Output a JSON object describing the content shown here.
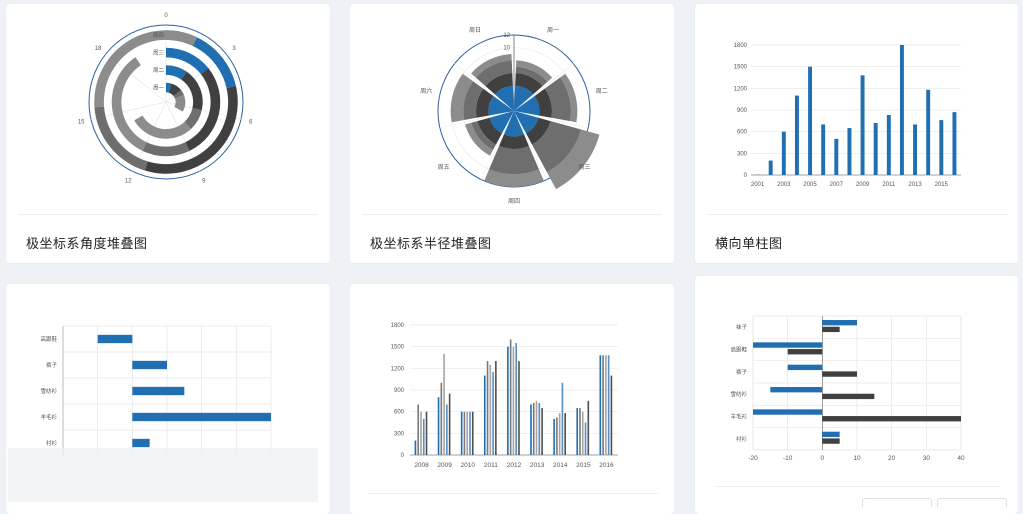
{
  "cards": [
    {
      "title": "极坐标系角度堆叠图"
    },
    {
      "title": "极坐标系半径堆叠图"
    },
    {
      "title": "横向单柱图"
    },
    {
      "title": ""
    },
    {
      "title": ""
    },
    {
      "title": ""
    }
  ],
  "colors": {
    "blue": "#1f6fb2",
    "dark": "#404040",
    "gray": "#6e6e6e",
    "light": "#8c8c8c"
  },
  "chart_data": [
    {
      "type": "bar",
      "subtype": "polar-angle-stacked",
      "angle_ticks": [
        "0",
        "3",
        "6",
        "9",
        "12",
        "15",
        "18"
      ],
      "angle_range": [
        0,
        21
      ],
      "categories": [
        "周一",
        "周二",
        "周三",
        "周四"
      ],
      "series": [
        {
          "values": [
            1,
            2,
            3,
            4.5
          ]
        },
        {
          "values": [
            2,
            4,
            6,
            7
          ]
        },
        {
          "values": [
            1,
            2,
            3,
            4
          ]
        },
        {
          "values": [
            3,
            6,
            7,
            7
          ]
        }
      ]
    },
    {
      "type": "bar",
      "subtype": "polar-radius-stacked",
      "categories": [
        "周一",
        "周二",
        "周三",
        "周四",
        "周五",
        "周六",
        "周日"
      ],
      "radial_ticks": [
        "4",
        "8",
        "10",
        "12"
      ],
      "series": [
        {
          "values": [
            4,
            4,
            4,
            4,
            4,
            4,
            4
          ]
        },
        {
          "values": [
            2,
            2,
            2,
            2,
            2,
            2,
            2
          ]
        },
        {
          "values": [
            1,
            3,
            5,
            4,
            1,
            2,
            2
          ]
        },
        {
          "values": [
            1,
            1,
            3,
            2,
            1,
            2,
            1
          ]
        }
      ]
    },
    {
      "type": "bar",
      "x": [
        2001,
        2002,
        2003,
        2004,
        2005,
        2006,
        2007,
        2008,
        2009,
        2010,
        2011,
        2012,
        2013,
        2014,
        2015,
        2016
      ],
      "x_tick_labels": [
        "2001",
        "2003",
        "2005",
        "2007",
        "2009",
        "2011",
        "2013",
        "2015"
      ],
      "values": [
        5,
        200,
        600,
        1100,
        1500,
        700,
        500,
        650,
        1380,
        720,
        830,
        1800,
        700,
        1180,
        760,
        870
      ],
      "y_ticks": [
        "0",
        "300",
        "600",
        "900",
        "1200",
        "1500",
        "1800"
      ],
      "ylim": [
        0,
        1800
      ]
    },
    {
      "type": "bar",
      "orientation": "horizontal",
      "categories": [
        "高跟鞋",
        "裤子",
        "雪纺衫",
        "羊毛衫",
        "衬衫"
      ],
      "values": [
        -10,
        10,
        15,
        40,
        5
      ],
      "xlim": [
        -20,
        40
      ]
    },
    {
      "type": "bar",
      "x": [
        2008,
        2009,
        2010,
        2011,
        2012,
        2013,
        2014,
        2015,
        2016
      ],
      "x_tick_labels": [
        "2008",
        "2009",
        "2010",
        "2011",
        "2012",
        "2013",
        "2014",
        "2015",
        "2016"
      ],
      "series": [
        {
          "values": [
            200,
            800,
            600,
            1100,
            1500,
            700,
            500,
            650,
            1380
          ]
        },
        {
          "values": [
            700,
            1000,
            600,
            1300,
            1600,
            720,
            520,
            650,
            1380
          ]
        },
        {
          "values": [
            600,
            1400,
            600,
            1250,
            1500,
            750,
            580,
            600,
            1380
          ]
        },
        {
          "values": [
            500,
            700,
            600,
            1150,
            1550,
            720,
            1000,
            450,
            1380
          ]
        },
        {
          "values": [
            600,
            850,
            600,
            1300,
            1300,
            650,
            580,
            750,
            1100
          ]
        }
      ],
      "y_ticks": [
        "0",
        "300",
        "600",
        "900",
        "1200",
        "1500",
        "1800"
      ],
      "ylim": [
        0,
        1800
      ]
    },
    {
      "type": "bar",
      "orientation": "horizontal",
      "categories": [
        "袜子",
        "高跟鞋",
        "裤子",
        "雪纺衫",
        "羊毛衫",
        "衬衫"
      ],
      "series": [
        {
          "values": [
            10,
            -20,
            -10,
            -15,
            -20,
            5
          ]
        },
        {
          "values": [
            5,
            -10,
            10,
            15,
            40,
            5
          ]
        }
      ],
      "x_ticks": [
        "-20",
        "-10",
        "0",
        "10",
        "20",
        "30",
        "40"
      ],
      "xlim": [
        -20,
        40
      ]
    }
  ]
}
